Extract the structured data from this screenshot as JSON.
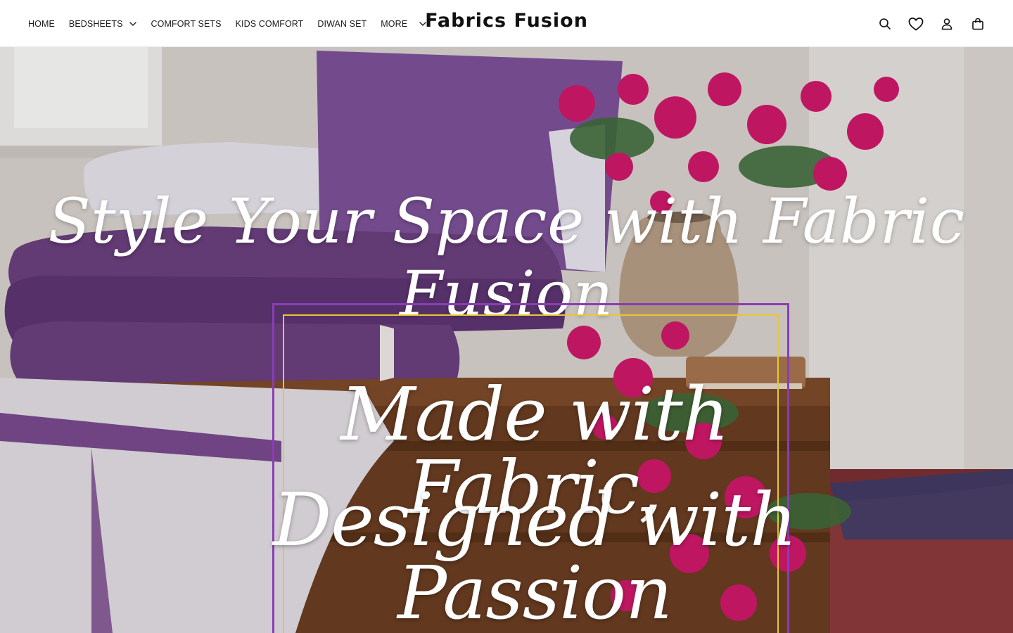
{
  "nav": {
    "items": [
      {
        "label": "HOME"
      },
      {
        "label": "BEDSHEETS"
      },
      {
        "label": "COMFORT SETS"
      },
      {
        "label": "KIDS COMFORT"
      },
      {
        "label": "DIWAN SET"
      },
      {
        "label": "MORE"
      }
    ]
  },
  "brand": {
    "name": "Fabrics Fusion"
  },
  "header_icons": [
    "search-icon",
    "heart-icon",
    "account-icon",
    "cart-icon"
  ],
  "hero": {
    "headline": "Style Your Space with Fabric Fusion",
    "tagline_line1": "Made with Fabric,",
    "tagline_line2": "Designed with Passion"
  },
  "colors": {
    "accent_purple": "#8a3db5",
    "accent_yellow": "#e6c832",
    "bedding_purple": "#6b3f7e",
    "flower_magenta": "#d0186b"
  }
}
